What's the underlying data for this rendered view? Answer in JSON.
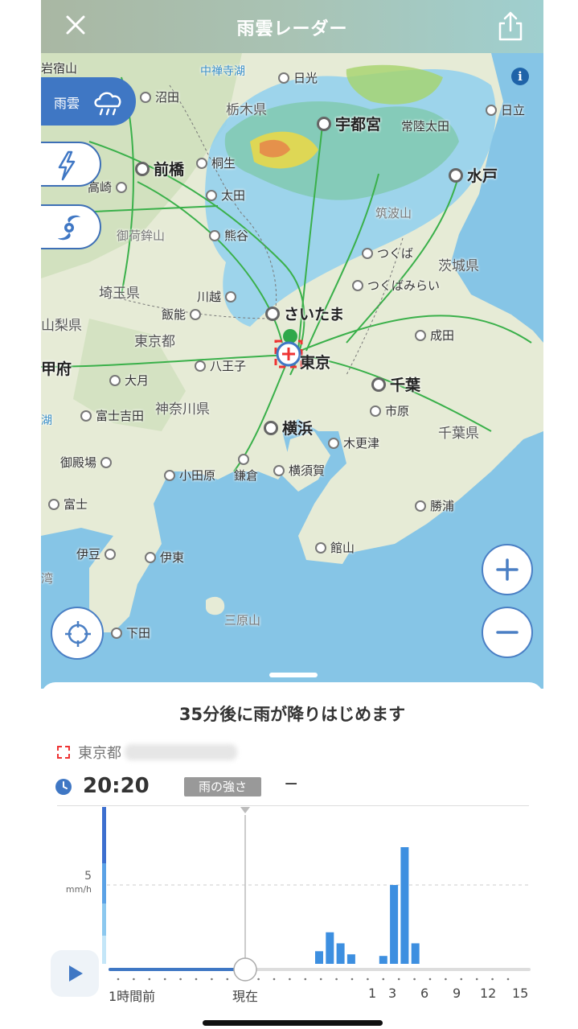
{
  "header": {
    "title": "雨雲レーダー"
  },
  "map": {
    "layers": [
      {
        "label": "雨雲",
        "icon": "rain-cloud-icon",
        "active": true
      },
      {
        "label": "",
        "icon": "lightning-icon",
        "active": false
      },
      {
        "label": "",
        "icon": "typhoon-icon",
        "active": false
      }
    ],
    "labels": {
      "iwajuku": "岩宿山",
      "chuzenji": "中禅寺湖",
      "nikko": "日光",
      "numata": "沼田",
      "tochigi": "栃木県",
      "utsunomiya": "宇都宮",
      "hitachiota": "常陸太田",
      "hitachi": "日立",
      "maebashi": "前橋",
      "kiryu": "桐生",
      "takasaki": "高崎",
      "ota": "太田",
      "mito": "水戸",
      "tsukubasan": "筑波山",
      "mikabosan": "御荷鉾山",
      "kumagaya": "熊谷",
      "tsukuba": "つくば",
      "ibaraki": "茨城県",
      "saitamapref": "埼玉県",
      "kawagoe": "川越",
      "tsukubamirai": "つくばみらい",
      "hanno": "飯能",
      "saitama": "さいたま",
      "yamanashi": "山梨県",
      "tokyoto": "東京都",
      "narita": "成田",
      "kofu": "甲府",
      "hachioji": "八王子",
      "tokyo": "東京",
      "otsuki": "大月",
      "chiba": "千葉",
      "fujiyoshida": "富士吉田",
      "kanagawa": "神奈川県",
      "ichihara": "市原",
      "kawaguchiko": "湖",
      "yokohama": "横浜",
      "kisarazu": "木更津",
      "chibapref": "千葉県",
      "gotemba": "御殿場",
      "kamakura": "鎌倉",
      "odawara": "小田原",
      "yokosuka": "横須賀",
      "fuji": "富士",
      "katsuura": "勝浦",
      "tateyama": "館山",
      "izu": "伊豆",
      "ito": "伊東",
      "wan": "湾",
      "mihara": "三原山",
      "shimoda": "下田"
    }
  },
  "forecast": {
    "headline": "35分後に雨が降りはじめます",
    "location": "東京都",
    "time": "20:20",
    "intensity_label": "雨の強さ",
    "intensity_value": "−",
    "y_tick": "5",
    "y_unit": "mm/h",
    "x_labels": [
      "1時間前",
      "現在",
      "1",
      "3",
      "6",
      "9",
      "12",
      "15"
    ]
  },
  "chart_data": {
    "type": "bar",
    "ylabel": "mm/h",
    "yticks": [
      5
    ],
    "current_label": "現在",
    "past_label": "1時間前",
    "future_ticks": [
      "1",
      "3",
      "6",
      "9",
      "12",
      "15"
    ],
    "forecast_bars_mm_h": [
      0.8,
      2.0,
      1.3,
      0.6,
      0,
      0,
      0.5,
      5.0,
      7.4,
      1.3
    ],
    "colors": {
      "bar": "#3d8fe0",
      "slider": "#3f77c4"
    }
  }
}
